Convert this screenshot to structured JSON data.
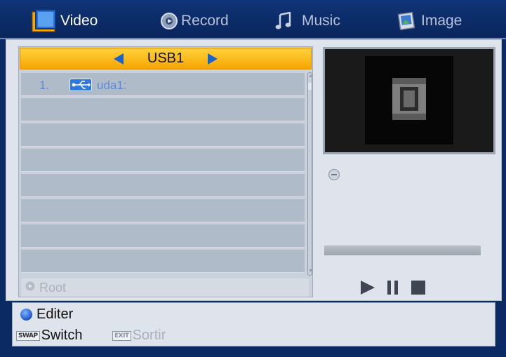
{
  "tabs": [
    {
      "label": "Video",
      "icon": "film-icon",
      "active": true
    },
    {
      "label": "Record",
      "icon": "record-icon",
      "active": false
    },
    {
      "label": "Music",
      "icon": "music-note-icon",
      "active": false
    },
    {
      "label": "Image",
      "icon": "picture-icon",
      "active": false
    }
  ],
  "browser": {
    "source": "USB1",
    "rows": [
      {
        "number": "1.",
        "icon": "usb-icon",
        "name": "uda1:"
      },
      {
        "number": "",
        "name": ""
      },
      {
        "number": "",
        "name": ""
      },
      {
        "number": "",
        "name": ""
      },
      {
        "number": "",
        "name": ""
      },
      {
        "number": "",
        "name": ""
      },
      {
        "number": "",
        "name": ""
      },
      {
        "number": "",
        "name": ""
      }
    ],
    "path": "Root"
  },
  "preview": {
    "icon": "film-strip-icon"
  },
  "playback": {
    "progress": 0,
    "controls": [
      "play-icon",
      "pause-icon",
      "stop-icon"
    ]
  },
  "help": {
    "edit_label": "Editer",
    "swap_key": "SWAP",
    "swap_label": "Switch",
    "exit_key": "EXIT",
    "exit_label": "Sortir"
  },
  "colors": {
    "background": "#0b2a63",
    "panel": "#dfe4ec",
    "source_bar": "#f7a500",
    "list_row": "#afbbc8",
    "accent_blue": "#1b63c9",
    "text_link": "#5f8bd4"
  }
}
